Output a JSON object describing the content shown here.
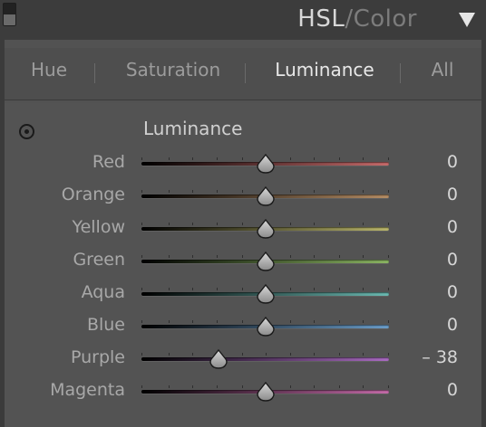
{
  "header": {
    "title_main": "HSL",
    "title_sep": "/",
    "title_secondary": "Color",
    "collapse_icon": "triangle-down-icon"
  },
  "tabs": [
    {
      "label": "Hue",
      "active": false
    },
    {
      "label": "Saturation",
      "active": false
    },
    {
      "label": "Luminance",
      "active": true
    },
    {
      "label": "All",
      "active": false
    }
  ],
  "section": {
    "title": "Luminance",
    "target_icon": "target-adjustment-icon"
  },
  "sliders": [
    {
      "label": "Red",
      "value": "0",
      "numeric": 0,
      "color": "#c66a6a"
    },
    {
      "label": "Orange",
      "value": "0",
      "numeric": 0,
      "color": "#b48c64"
    },
    {
      "label": "Yellow",
      "value": "0",
      "numeric": 0,
      "color": "#b8b46a"
    },
    {
      "label": "Green",
      "value": "0",
      "numeric": 0,
      "color": "#8ab462"
    },
    {
      "label": "Aqua",
      "value": "0",
      "numeric": 0,
      "color": "#6ab8b0"
    },
    {
      "label": "Blue",
      "value": "0",
      "numeric": 0,
      "color": "#6a9cc8"
    },
    {
      "label": "Purple",
      "value": "– 38",
      "numeric": -38,
      "color": "#a86ac0"
    },
    {
      "label": "Magenta",
      "value": "0",
      "numeric": 0,
      "color": "#c46aa8"
    }
  ]
}
